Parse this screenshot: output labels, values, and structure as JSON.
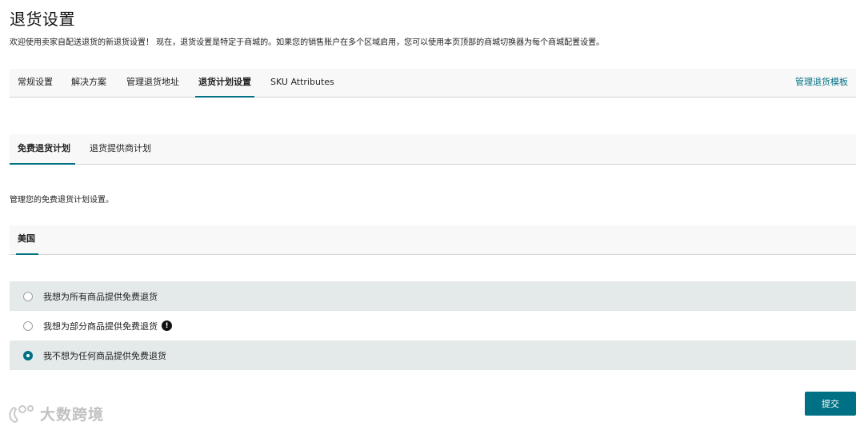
{
  "page": {
    "title": "退货设置",
    "intro": "欢迎使用卖家自配送退货的新退货设置！ 现在，退货设置是特定于商城的。如果您的销售账户在多个区域启用，您可以使用本页顶部的商城切换器为每个商城配置设置。"
  },
  "tabs": [
    {
      "label": "常规设置",
      "active": false
    },
    {
      "label": "解决方案",
      "active": false
    },
    {
      "label": "管理退货地址",
      "active": false
    },
    {
      "label": "退货计划设置",
      "active": true
    },
    {
      "label": "SKU Attributes",
      "active": false
    }
  ],
  "manage_template_link": "管理退货模板",
  "subtabs": [
    {
      "label": "免费退货计划",
      "active": true
    },
    {
      "label": "退货提供商计划",
      "active": false
    }
  ],
  "section_description": "管理您的免费退货计划设置。",
  "region_tab": "美国",
  "options": [
    {
      "label": "我想为所有商品提供免费退货",
      "selected": false,
      "has_info": false
    },
    {
      "label": "我想为部分商品提供免费退货",
      "selected": false,
      "has_info": true
    },
    {
      "label": "我不想为任何商品提供免费退货",
      "selected": true,
      "has_info": false
    }
  ],
  "info_glyph": "!",
  "submit_label": "提交",
  "watermark_text": "大数跨境",
  "colors": {
    "accent": "#007185",
    "row_shade": "#e4eaea",
    "bar_bg": "#f8f8f8"
  }
}
